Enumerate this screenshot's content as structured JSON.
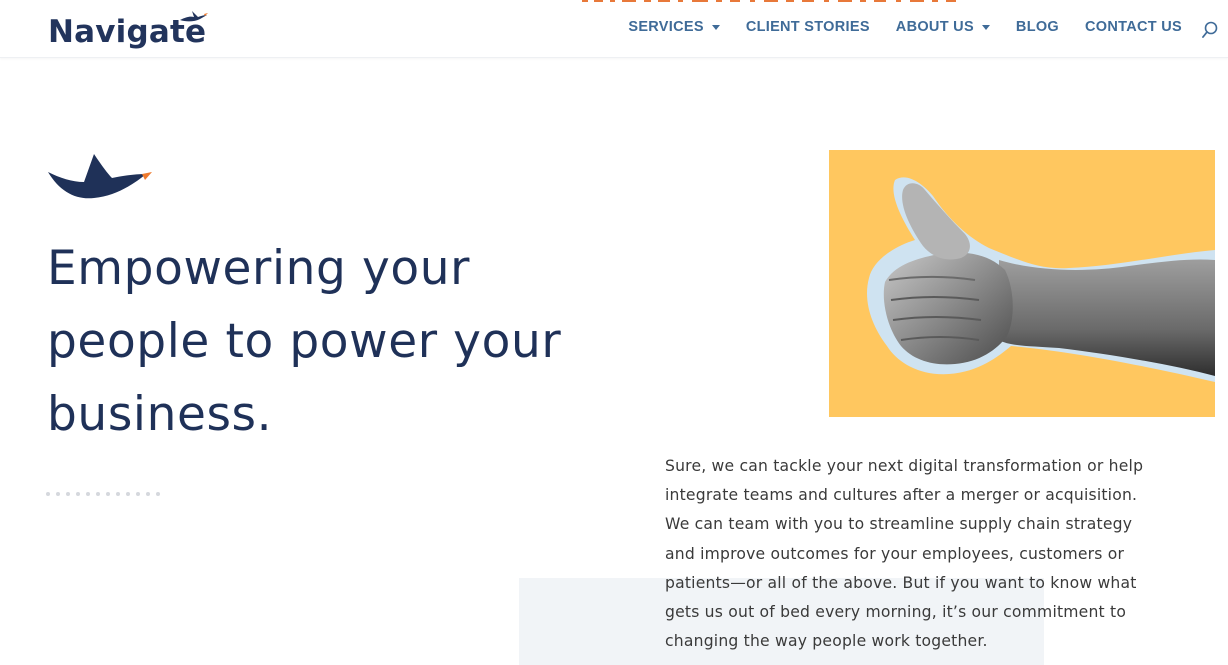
{
  "brand": {
    "logo_text": "Navigate",
    "navy": "#22345c",
    "accent_orange": "#ee7a2e",
    "nav_blue": "#3f6b98",
    "panel_yellow": "#ffc75f"
  },
  "nav": {
    "items": [
      {
        "label": "SERVICES",
        "has_dropdown": true
      },
      {
        "label": "CLIENT STORIES",
        "has_dropdown": false
      },
      {
        "label": "ABOUT US",
        "has_dropdown": true
      },
      {
        "label": "BLOG",
        "has_dropdown": false
      },
      {
        "label": "CONTACT US",
        "has_dropdown": false
      }
    ],
    "search_icon": "search-icon"
  },
  "hero": {
    "bird_icon": "bird-icon",
    "title_line_1": "Empowering your",
    "title_line_2": "people to power your",
    "title_line_3": "business.",
    "image": "thumbs-up-hand-photo"
  },
  "intro": {
    "text": "Sure, we can tackle your next digital transformation or help integrate teams and cultures after a merger or acquisition. We can team with you to streamline supply chain strategy and improve outcomes for your employees, customers or patients—or all of the above. But if you want to know what gets us out of bed every morning, it’s our commitment to changing the way people work together."
  }
}
